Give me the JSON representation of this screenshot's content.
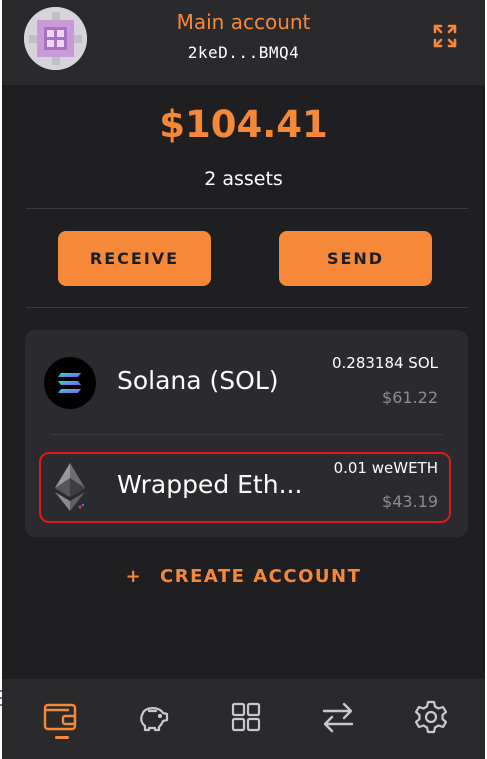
{
  "header": {
    "account_name": "Main account",
    "account_address": "2keD...BMQ4",
    "avatar_icon": "identicon-avatar",
    "expand_icon": "expand-icon"
  },
  "summary": {
    "balance": "$104.41",
    "assets_count": "2 assets"
  },
  "actions": {
    "receive_label": "RECEIVE",
    "send_label": "SEND"
  },
  "assets": [
    {
      "name": "Solana (SOL)",
      "amount": "0.283184 SOL",
      "usd_value": "$61.22",
      "icon": "solana-icon"
    },
    {
      "name": "Wrapped Eth...",
      "amount": "0.01 weWETH",
      "usd_value": "$43.19",
      "icon": "ethereum-icon"
    }
  ],
  "create_account": {
    "plus": "+",
    "label": "CREATE ACCOUNT"
  },
  "nav": {
    "items": [
      {
        "icon": "wallet-icon",
        "active": true
      },
      {
        "icon": "piggy-bank-icon",
        "active": false
      },
      {
        "icon": "apps-grid-icon",
        "active": false
      },
      {
        "icon": "swap-icon",
        "active": false
      },
      {
        "icon": "settings-gear-icon",
        "active": false
      }
    ]
  },
  "colors": {
    "accent": "#f6883a",
    "background": "#1f1f22",
    "card": "#2b2b2f",
    "highlight_border": "#e01818"
  }
}
